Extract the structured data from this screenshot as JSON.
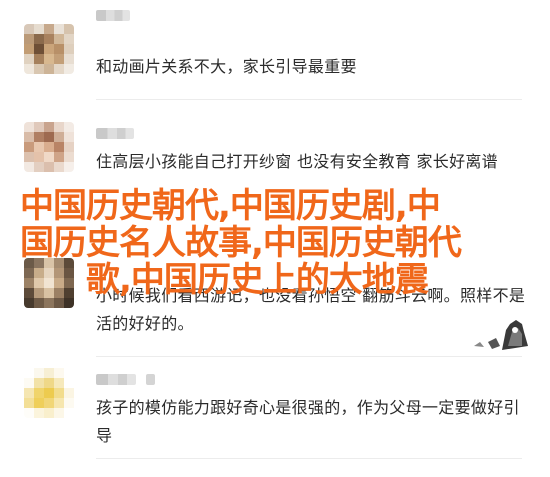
{
  "comments": [
    {
      "text": "和动画片关系不大，家长引导最重要"
    },
    {
      "text": "住高层小孩能自己打开纱窗 也没有安全教育 家长好离谱"
    },
    {
      "text": "小时候我们看西游记，也没看孙悟空 翻筋斗云啊。照样不是活的好好的。"
    },
    {
      "text": "孩子的模仿能力跟好奇心是很强的，作为父母一定要做好引导"
    }
  ],
  "overlay": {
    "line1": "中国历史朝代,中国历史剧,中",
    "line2": "国历史名人故事,中国历史朝代",
    "line3": "歌,中国历史上的大地震"
  },
  "colors": {
    "overlay_text": "#f0671a",
    "body_text": "#2b2b2b"
  },
  "icons": [
    "avatar",
    "sticker-icon"
  ]
}
